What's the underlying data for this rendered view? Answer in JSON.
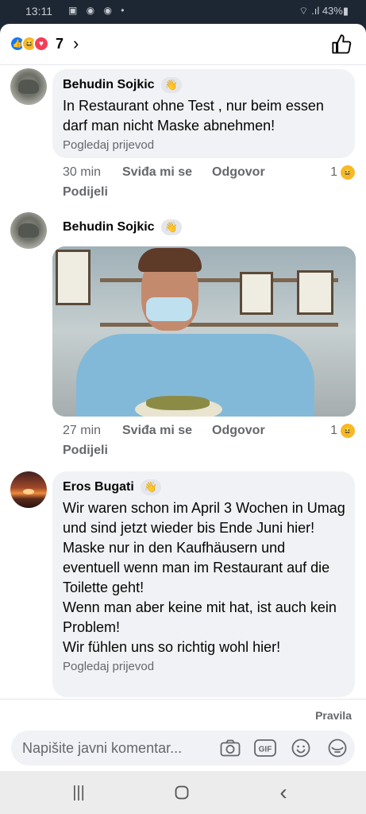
{
  "status_bar": {
    "time": "13:11",
    "left_icons": "▣ ◉ ◉ •",
    "right": "⌔ .ıl 43%▮"
  },
  "reactions": {
    "count": "7",
    "chevron": "›",
    "types": [
      "like-icon",
      "haha-icon",
      "love-icon"
    ]
  },
  "comments": [
    {
      "author": "Behudin Sojkic",
      "badge": "👋",
      "text": "In Restaurant ohne Test , nur beim essen darf man nicht Maske abnehmen!",
      "translate": "Pogledaj prijevod",
      "time": "30 min",
      "like_label": "Sviđa mi se",
      "reply_label": "Odgovor",
      "share_label": "Podijeli",
      "reaction_count": "1"
    },
    {
      "author": "Behudin Sojkic",
      "badge": "👋",
      "time": "27 min",
      "like_label": "Sviđa mi se",
      "reply_label": "Odgovor",
      "share_label": "Podijeli",
      "reaction_count": "1"
    },
    {
      "author": "Eros Bugati",
      "badge": "👋",
      "text": "Wir waren schon im April 3 Wochen in Umag und sind jetzt wieder bis Ende Juni hier!\nMaske nur in den Kaufhäusern und eventuell wenn man im Restaurant auf die Toilette geht!\nWenn man aber keine mit hat, ist auch kein Problem!\nWir fühlen uns so richtig wohl hier!",
      "translate": "Pogledaj prijevod"
    }
  ],
  "footer": {
    "rules": "Pravila",
    "composer_placeholder": "Napišite javni komentar...",
    "gif": "GIF"
  },
  "nav": {
    "recents": "|||",
    "home": "○",
    "back": "‹"
  },
  "colors": {
    "accent": "#1877f2",
    "bubble": "#f0f2f5",
    "secondary_text": "#65676b"
  }
}
